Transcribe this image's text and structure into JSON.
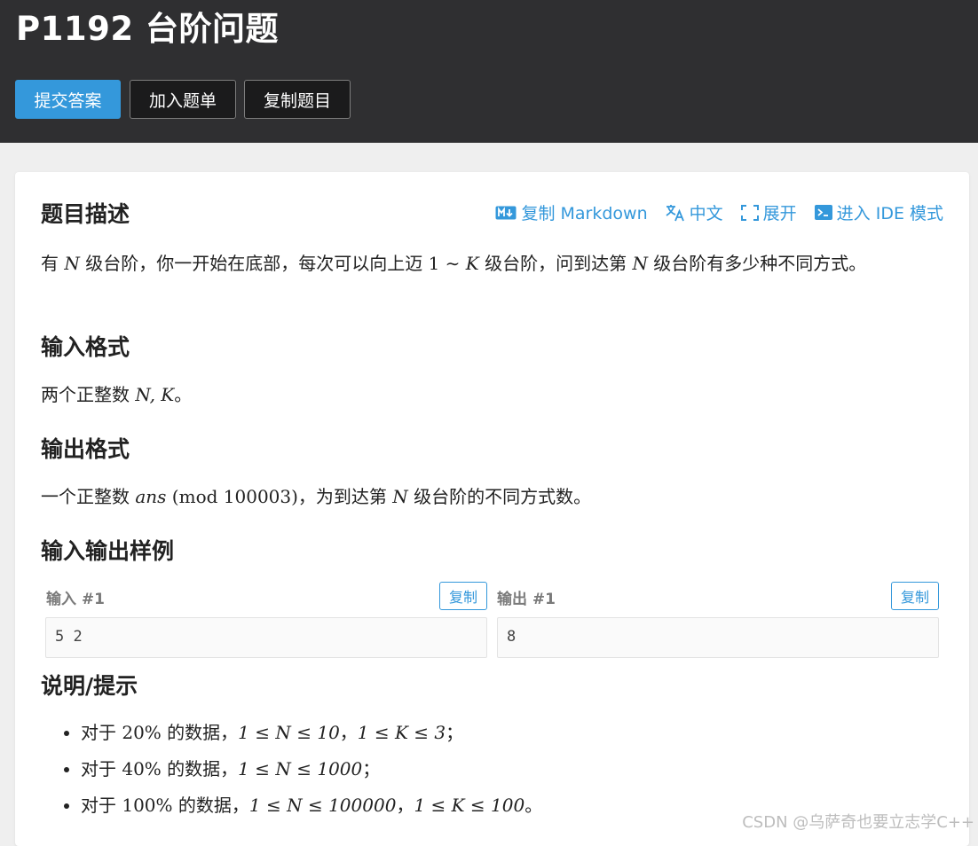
{
  "header": {
    "title": "P1192 台阶问题",
    "buttons": {
      "submit": "提交答案",
      "add_to_list": "加入题单",
      "copy_problem": "复制题目"
    }
  },
  "toolbar": {
    "copy_markdown": "复制 Markdown",
    "language": "中文",
    "expand": "展开",
    "ide_mode": "进入 IDE 模式"
  },
  "sections": {
    "description": {
      "title": "题目描述",
      "text_1": "有 ",
      "var_n": "N",
      "text_2": " 级台阶，你一开始在底部，每次可以向上迈 ",
      "range": "1 ∼ ",
      "var_k": "K",
      "text_3": " 级台阶，问到达第 ",
      "var_n2": "N",
      "text_4": " 级台阶有多少种不同方式。"
    },
    "input_format": {
      "title": "输入格式",
      "text_1": "两个正整数 ",
      "vars": "N, K",
      "text_2": "。"
    },
    "output_format": {
      "title": "输出格式",
      "text_1": "一个正整数 ",
      "var_ans": "ans",
      "mod": " (mod 100003)",
      "text_2": "，为到达第 ",
      "var_n": "N",
      "text_3": " 级台阶的不同方式数。"
    },
    "samples": {
      "title": "输入输出样例",
      "input_label": "输入 #1",
      "output_label": "输出 #1",
      "copy_label": "复制",
      "input_value": "5 2",
      "output_value": "8"
    },
    "hints": {
      "title": "说明/提示",
      "items": [
        {
          "prefix": "对于 ",
          "pct": "20%",
          "mid": " 的数据，",
          "m1": "1 ≤ N ≤ 10",
          "sep": "，",
          "m2": "1 ≤ K ≤ 3",
          "end": "；"
        },
        {
          "prefix": "对于 ",
          "pct": "40%",
          "mid": " 的数据，",
          "m1": "1 ≤ N ≤ 1000",
          "sep": "",
          "m2": "",
          "end": "；"
        },
        {
          "prefix": "对于 ",
          "pct": "100%",
          "mid": " 的数据，",
          "m1": "1 ≤ N ≤ 100000",
          "sep": "，",
          "m2": "1 ≤ K ≤ 100",
          "end": "。"
        }
      ]
    }
  },
  "watermark": "CSDN @乌萨奇也要立志学C++",
  "colors": {
    "accent": "#3498db",
    "header_bg": "#2f2f31",
    "page_bg": "#efefef"
  }
}
